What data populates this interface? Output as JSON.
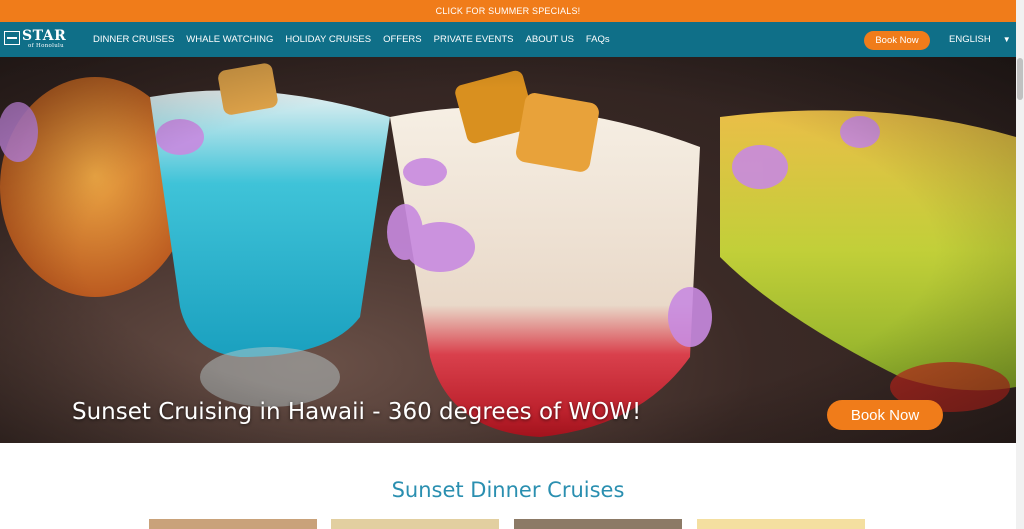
{
  "promo": {
    "text": "CLICK FOR SUMMER SPECIALS!"
  },
  "logo": {
    "name": "STAR",
    "sub": "of Honolulu"
  },
  "nav": {
    "items": [
      "DINNER CRUISES",
      "WHALE WATCHING",
      "HOLIDAY CRUISES",
      "OFFERS",
      "PRIVATE EVENTS",
      "ABOUT US",
      "FAQs"
    ],
    "book_label": "Book Now",
    "language": "ENGLISH"
  },
  "hero": {
    "title": "Sunset Cruising in Hawaii - 360 degrees of WOW!",
    "button_label": "Book Now"
  },
  "section": {
    "title": "Sunset Dinner Cruises"
  },
  "colors": {
    "accent": "#f07c1a",
    "nav_bg": "#0f6f88",
    "heading": "#2a8fb0"
  }
}
